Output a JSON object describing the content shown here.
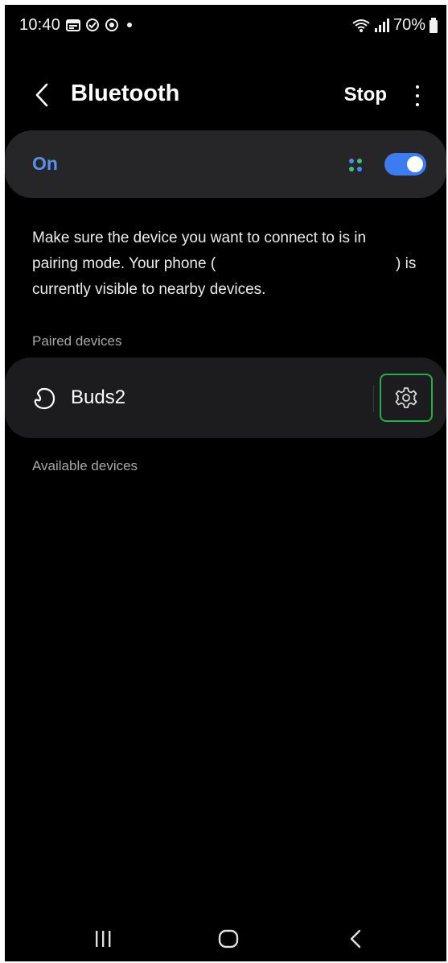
{
  "status_bar": {
    "time": "10:40",
    "battery": "70%",
    "icons": [
      "calendar-icon",
      "sync-icon",
      "location-icon",
      "notification-dot",
      "wifi-calling-icon",
      "signal-icon",
      "battery-icon"
    ]
  },
  "header": {
    "title": "Bluetooth",
    "stop_label": "Stop",
    "back_icon": "back-chevron-icon",
    "more_icon": "more-options-icon"
  },
  "bluetooth_toggle": {
    "label": "On",
    "state": true,
    "accent_color": "#3c7cf0"
  },
  "description": {
    "line1": "Make sure the device you want to connect to is in",
    "line2_start": "pairing mode. Your phone (",
    "line2_end": ") is",
    "line3": "currently visible to nearby devices."
  },
  "paired_section": {
    "label": "Paired devices",
    "devices": [
      {
        "name": "Buds2",
        "icon": "earbuds-icon",
        "settings_icon": "gear-icon"
      }
    ]
  },
  "available_section": {
    "label": "Available devices"
  },
  "nav_bar": {
    "recents_icon": "recents-icon",
    "home_icon": "home-icon",
    "back_icon": "back-icon"
  }
}
